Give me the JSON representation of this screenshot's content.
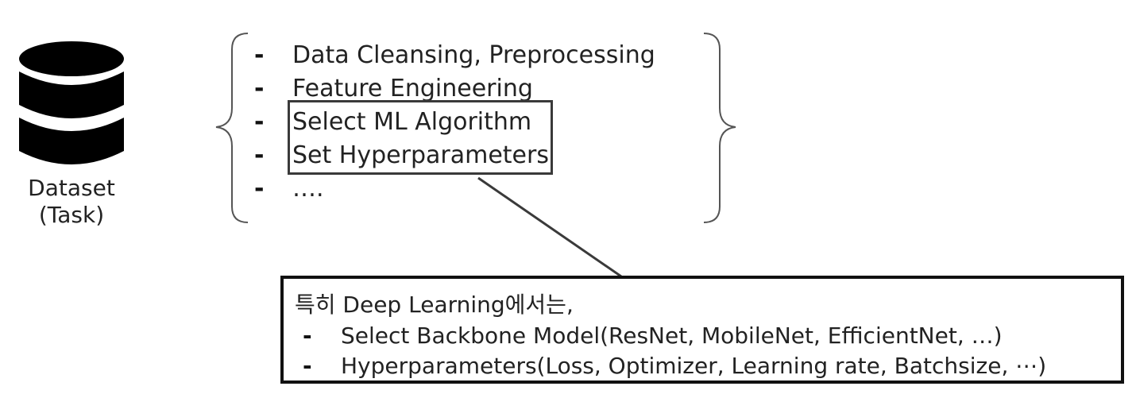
{
  "dataset": {
    "icon": "database-icon",
    "label_line1": "Dataset",
    "label_line2": "(Task)"
  },
  "steps": [
    {
      "bullet": "-",
      "text": "Data Cleansing, Preprocessing"
    },
    {
      "bullet": "-",
      "text": "Feature Engineering"
    },
    {
      "bullet": "-",
      "text": "Select ML Algorithm"
    },
    {
      "bullet": "-",
      "text": "Set Hyperparameters"
    },
    {
      "bullet": "-",
      "text": "…."
    }
  ],
  "callout": {
    "title": "특히 Deep Learning에서는,",
    "items": [
      {
        "bullet": "-",
        "text": "Select Backbone Model(ResNet, MobileNet, EfficientNet, …)"
      },
      {
        "bullet": "-",
        "text": "Hyperparameters(Loss, Optimizer, Learning rate, Batchsize, ⋯)"
      }
    ]
  },
  "colors": {
    "icon": "#000000",
    "text": "#222222",
    "highlight_border": "#3a3a3a",
    "callout_border": "#111111",
    "brace": "#555555"
  }
}
